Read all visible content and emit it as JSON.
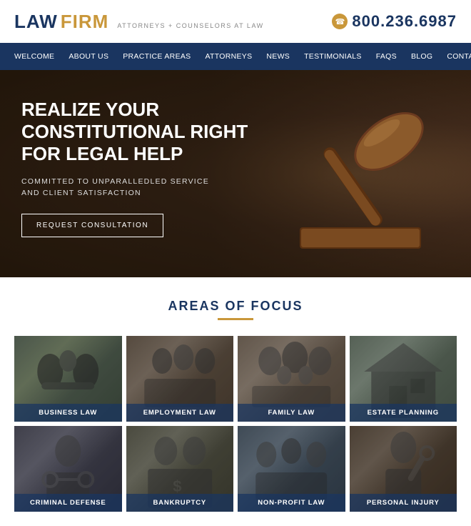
{
  "header": {
    "logo_law": "LAW",
    "logo_firm": "FIRM",
    "tagline": "ATTORNEYS + COUNSELORS AT LAW",
    "phone_number": "800.236.6987"
  },
  "nav": {
    "items": [
      {
        "label": "WELCOME"
      },
      {
        "label": "ABOUT US"
      },
      {
        "label": "PRACTICE AREAS"
      },
      {
        "label": "ATTORNEYS"
      },
      {
        "label": "NEWS"
      },
      {
        "label": "TESTIMONIALS"
      },
      {
        "label": "FAQS"
      },
      {
        "label": "BLOG"
      },
      {
        "label": "CONTACT US"
      }
    ]
  },
  "hero": {
    "title": "REALIZE YOUR CONSTITUTIONAL RIGHT FOR LEGAL HELP",
    "subtitle": "COMMITTED TO UNPARALLEDLED SERVICE\nAND CLIENT SATISFACTION",
    "cta_label": "REQUEST CONSULTATION"
  },
  "areas": {
    "section_title": "AREAS OF FOCUS",
    "cards": [
      {
        "label": "BUSINESS LAW",
        "bg_class": "bg-business"
      },
      {
        "label": "EMPLOYMENT LAW",
        "bg_class": "bg-employment"
      },
      {
        "label": "FAMILY LAW",
        "bg_class": "bg-family"
      },
      {
        "label": "ESTATE PLANNING",
        "bg_class": "bg-estate"
      },
      {
        "label": "CRIMINAL DEFENSE",
        "bg_class": "bg-criminal"
      },
      {
        "label": "BANKRUPTCY",
        "bg_class": "bg-bankruptcy"
      },
      {
        "label": "NON-PROFIT LAW",
        "bg_class": "bg-nonprofit"
      },
      {
        "label": "PERSONAL INJURY",
        "bg_class": "bg-personal"
      }
    ]
  }
}
